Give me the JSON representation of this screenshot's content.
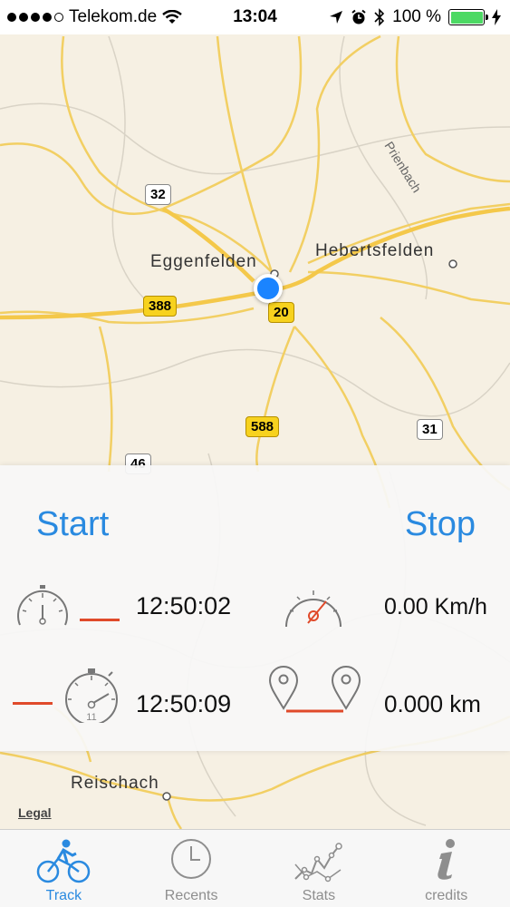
{
  "status_bar": {
    "carrier": "Telekom.de",
    "time": "13:04",
    "battery": "100 %",
    "icons": [
      "signal-dots-icon",
      "wifi-icon",
      "location-arrow-icon",
      "alarm-icon",
      "bluetooth-icon",
      "battery-icon",
      "charging-bolt-icon"
    ]
  },
  "map": {
    "places": [
      "Eggenfelden",
      "Hebertsfelden",
      "Reischach"
    ],
    "river": "Prienbach",
    "road_shields": [
      "32",
      "388",
      "20",
      "588",
      "31",
      "46"
    ],
    "legal": "Legal"
  },
  "panel": {
    "start_label": "Start",
    "stop_label": "Stop",
    "start_time": "12:50:02",
    "current_time": "12:50:09",
    "speed": "0.00 Km/h",
    "distance": "0.000 km",
    "stopwatch_number": "11"
  },
  "tabs": [
    {
      "label": "Track",
      "icon": "bicycle-icon",
      "active": true
    },
    {
      "label": "Recents",
      "icon": "clock-icon",
      "active": false
    },
    {
      "label": "Stats",
      "icon": "stats-graph-icon",
      "active": false
    },
    {
      "label": "credits",
      "icon": "info-icon",
      "active": false
    }
  ],
  "colors": {
    "accent": "#2a8ae0",
    "location_dot": "#1a84ff",
    "dash": "#e04a2a",
    "road": "#f4c84a",
    "battery": "#4cd964"
  }
}
